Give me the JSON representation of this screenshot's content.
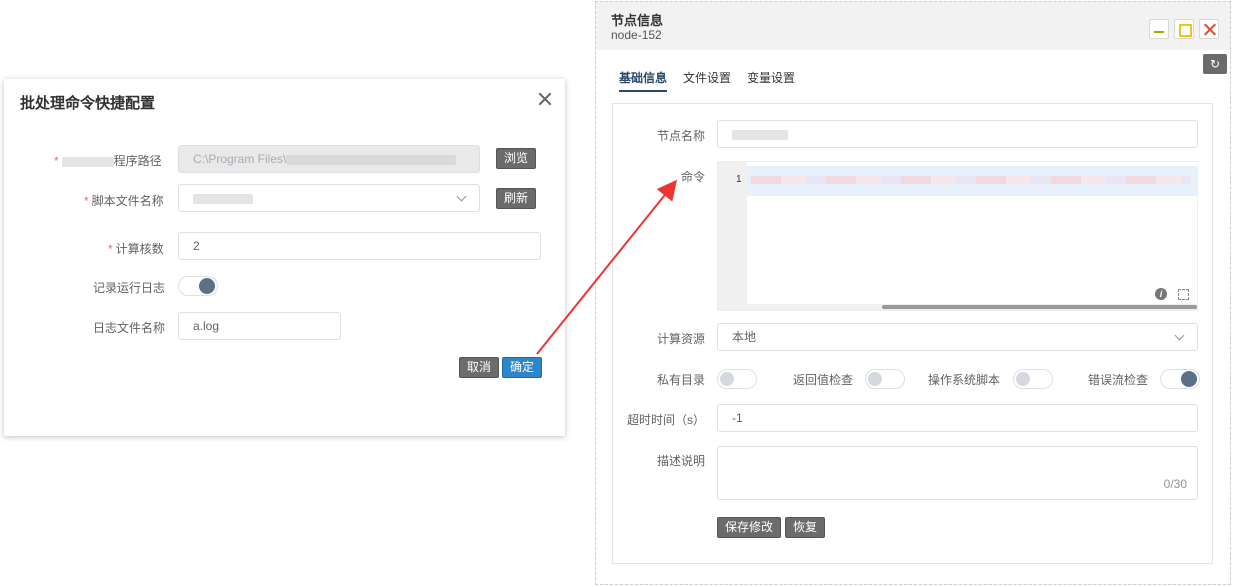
{
  "dialog": {
    "title": "批处理命令快捷配置",
    "program_path_label": "程序路径",
    "program_path_value": "C:\\Program Files\\",
    "browse_label": "浏览",
    "script_name_label": "脚本文件名称",
    "script_name_value": "",
    "refresh_label": "刷新",
    "cores_label": "计算核数",
    "cores_value": "2",
    "log_label": "记录运行日志",
    "log_enabled": true,
    "logfile_label": "日志文件名称",
    "logfile_value": "a.log",
    "cancel_label": "取消",
    "confirm_label": "确定"
  },
  "panel": {
    "title": "节点信息",
    "subtitle": "node-152",
    "tabs": [
      {
        "label": "基础信息",
        "active": true
      },
      {
        "label": "文件设置",
        "active": false
      },
      {
        "label": "变量设置",
        "active": false
      }
    ],
    "node_name_label": "节点名称",
    "node_name_value": "",
    "command_label": "命令",
    "command_line_number": "1",
    "compute_label": "计算资源",
    "compute_value": "本地",
    "private_dir_label": "私有目录",
    "return_check_label": "返回值检查",
    "os_script_label": "操作系统脚本",
    "error_check_label": "错误流检查",
    "toggles": {
      "private_dir": false,
      "return_check": false,
      "os_script": false,
      "error_check": true
    },
    "timeout_label": "超时时间（s）",
    "timeout_value": "-1",
    "desc_label": "描述说明",
    "desc_counter": "0/30",
    "save_label": "保存修改",
    "restore_label": "恢复"
  },
  "colors": {
    "accent": "#2b4a6b",
    "required": "#f56c6c",
    "arrow": "#ee3333",
    "toggle_on": "#5b7187"
  }
}
